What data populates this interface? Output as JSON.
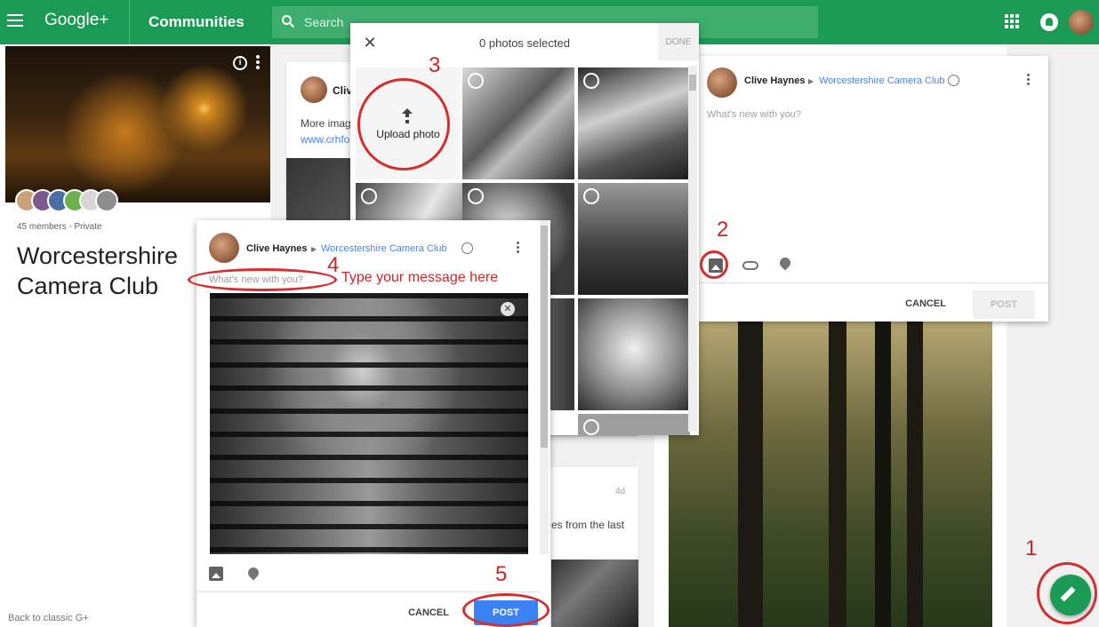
{
  "header": {
    "brand": "Google+",
    "section": "Communities",
    "search_placeholder": "Search"
  },
  "community": {
    "members_text": "45 members - Private",
    "title": "Worcestershire Camera Club",
    "back_link": "Back to classic G+"
  },
  "feed": {
    "post1_author_partial": "Cliv",
    "post1_text_partial": "More imag",
    "post1_link_partial": "www.crhfo",
    "post2_time": "4d",
    "post2_text_partial": "es from the last"
  },
  "compose_top": {
    "author": "Clive Haynes",
    "community": "Worcestershire Camera Club",
    "placeholder": "What's new with you?",
    "cancel_label": "CANCEL",
    "post_label": "POST"
  },
  "picker": {
    "title": "0 photos selected",
    "done_label": "DONE",
    "upload_label": "Upload photo"
  },
  "compose_main": {
    "author": "Clive Haynes",
    "community": "Worcestershire Camera Club",
    "placeholder": "What's new with you?",
    "cancel_label": "CANCEL",
    "post_label": "POST"
  },
  "annotations": {
    "step1": "1",
    "step2": "2",
    "step3": "3",
    "step4": "4",
    "step5": "5",
    "hint": "Type your message here"
  },
  "colors": {
    "brand_green": "#1a9a54",
    "link_blue": "#4285f4",
    "post_blue": "#3b82f6",
    "annotation_red": "#c62828"
  },
  "icons": [
    "hamburger-icon",
    "search-icon",
    "apps-icon",
    "notifications-icon",
    "info-icon",
    "more-icon",
    "close-icon",
    "upload-icon",
    "photo-icon",
    "link-icon",
    "place-icon",
    "edit-icon"
  ]
}
